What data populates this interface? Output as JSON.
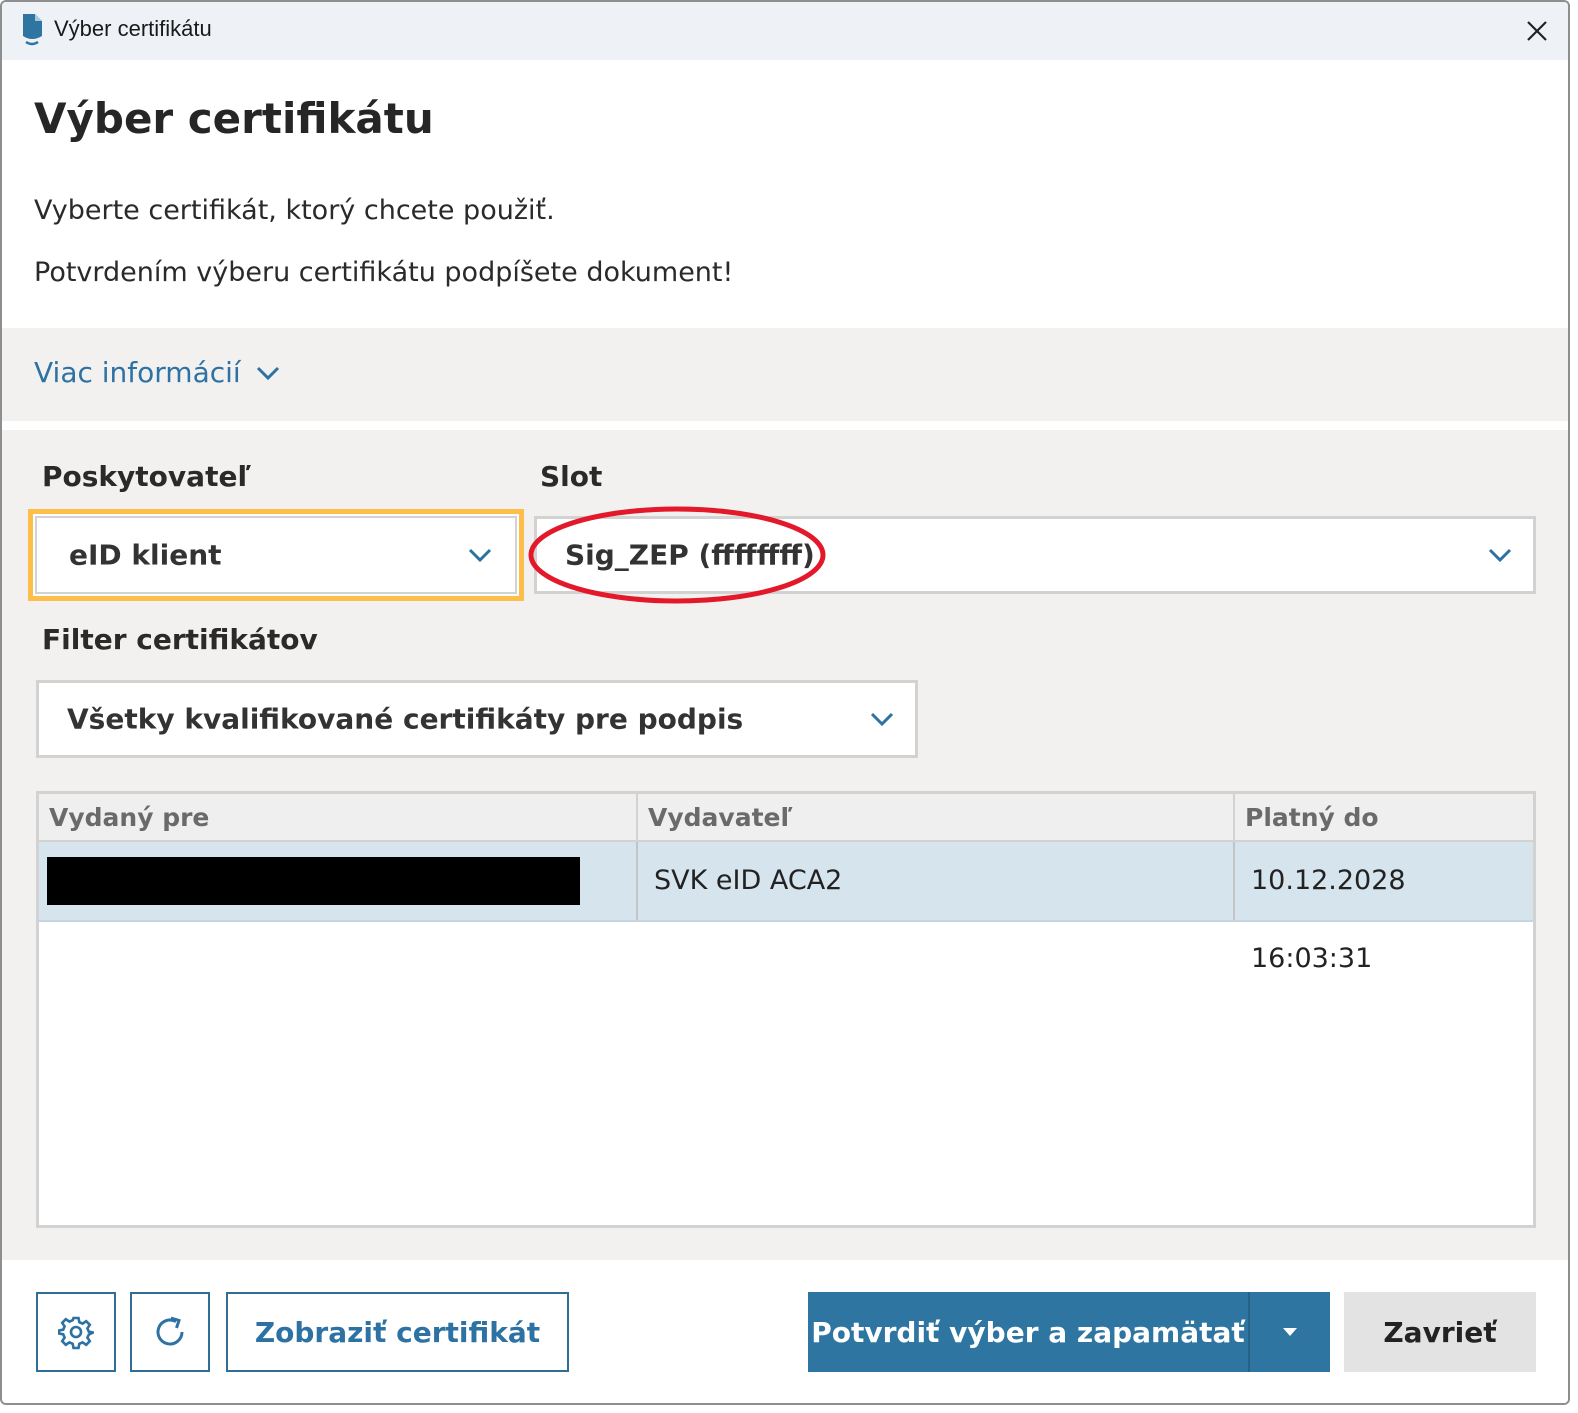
{
  "window": {
    "title": "Výber certifikátu"
  },
  "header": {
    "heading": "Výber certifikátu",
    "description": "Vyberte certifikát, ktorý chcete použiť.",
    "warning": "Potvrdením výberu certifikátu podpíšete dokument!"
  },
  "more_info": {
    "label": "Viac informácií"
  },
  "provider": {
    "label": "Poskytovateľ",
    "value": "eID klient"
  },
  "slot": {
    "label": "Slot",
    "value": "Sig_ZEP (ffffffff)"
  },
  "filter": {
    "label": "Filter certifikátov",
    "value": "Všetky kvalifikované certifikáty pre podpis"
  },
  "table": {
    "columns": [
      "Vydaný pre",
      "Vydavateľ",
      "Platný do"
    ],
    "rows": [
      {
        "issued_to": "",
        "issuer": "SVK eID ACA2",
        "valid_to": "10.12.2028 16:03:31"
      }
    ]
  },
  "footer": {
    "show_certificate": "Zobraziť certifikát",
    "confirm": "Potvrdiť výber a zapamätať",
    "close": "Zavrieť"
  },
  "colors": {
    "accent": "#2e76a1",
    "focus": "#fdbf4a",
    "annotation": "#e3182a",
    "selected_row": "#d6e4ee"
  },
  "icons": [
    "app-document-icon",
    "close-icon",
    "chevron-down-icon",
    "gear-icon",
    "refresh-icon",
    "caret-down-icon"
  ]
}
